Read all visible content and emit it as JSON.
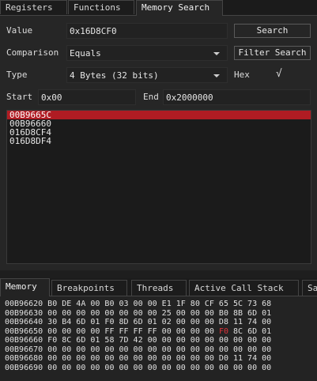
{
  "top_tabs": [
    "Registers",
    "Functions",
    "Memory Search"
  ],
  "form": {
    "value_label": "Value",
    "value": "0x16D8CF0",
    "search_button": "Search",
    "comparison_label": "Comparison",
    "comparison_value": "Equals",
    "filter_button": "Filter Search",
    "type_label": "Type",
    "type_value": "4 Bytes (32 bits)",
    "hex_label": "Hex",
    "hex_check": "√",
    "start_label": "Start",
    "start_value": "0x00",
    "end_label": "End",
    "end_value": "0x2000000"
  },
  "results": [
    "00B9665C",
    "00B96660",
    "016D8CF4",
    "016D8DF4"
  ],
  "bottom_tabs": [
    "Memory",
    "Breakpoints",
    "Threads",
    "Active Call Stack",
    "Sa"
  ],
  "memory_rows": [
    {
      "pre": "00B96620 B0 DE 4A 00 B0 03 00 00 E1 1F 80 CF 65 5C 73 68",
      "hl": "",
      "post": ""
    },
    {
      "pre": "00B96630 00 00 00 00 00 00 00 00 25 00 00 00 B0 8B 6D 01",
      "hl": "",
      "post": ""
    },
    {
      "pre": "00B96640 30 B4 6D 01 F0 8D 6D 01 02 00 00 00 D8 11 74 00",
      "hl": "",
      "post": ""
    },
    {
      "pre": "00B96650 00 00 00 00 FF FF FF FF 00 00 00 00 ",
      "hl": "F0",
      "post": " 8C 6D 01"
    },
    {
      "pre": "00B96660 F0 8C 6D 01 58 7D 42 00 00 00 00 00 00 00 00 00",
      "hl": "",
      "post": ""
    },
    {
      "pre": "00B96670 00 00 00 00 00 00 00 00 00 00 00 00 00 00 00 00",
      "hl": "",
      "post": ""
    },
    {
      "pre": "00B96680 00 00 00 00 00 00 00 00 00 00 00 00 D0 11 74 00",
      "hl": "",
      "post": ""
    },
    {
      "pre": "00B96690 00 00 00 00 00 00 00 00 00 00 00 00 00 00 00 00",
      "hl": "",
      "post": ""
    }
  ]
}
